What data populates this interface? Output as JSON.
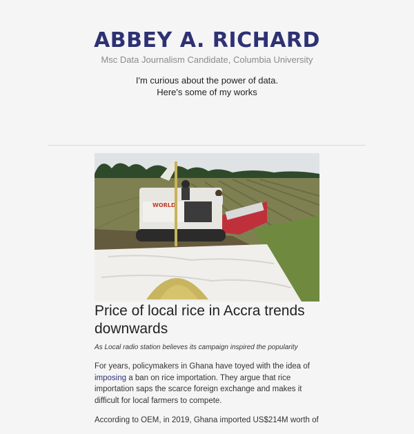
{
  "header": {
    "name": "ABBEY A. RICHARD",
    "subtitle": "Msc Data Journalism Candidate, Columbia University",
    "tagline_line1": "I'm curious about the power of data.",
    "tagline_line2": "Here's some of my works"
  },
  "article": {
    "title": "Price of local rice in Accra trends downwards",
    "caption": "As Local radio station believes its campaign inspired the popularity",
    "para1_before": "For years, policymakers in Ghana have toyed with the idea of ",
    "para1_link": "imposing",
    "para1_after": " a ban on rice importation. They argue that rice importation saps the scarce foreign exchange and makes it difficult for local farmers to compete.",
    "para2": "According to OEM, in 2019, Ghana imported US$214M worth of"
  },
  "colors": {
    "accent": "#2e3173",
    "background": "#f5f5f5"
  }
}
